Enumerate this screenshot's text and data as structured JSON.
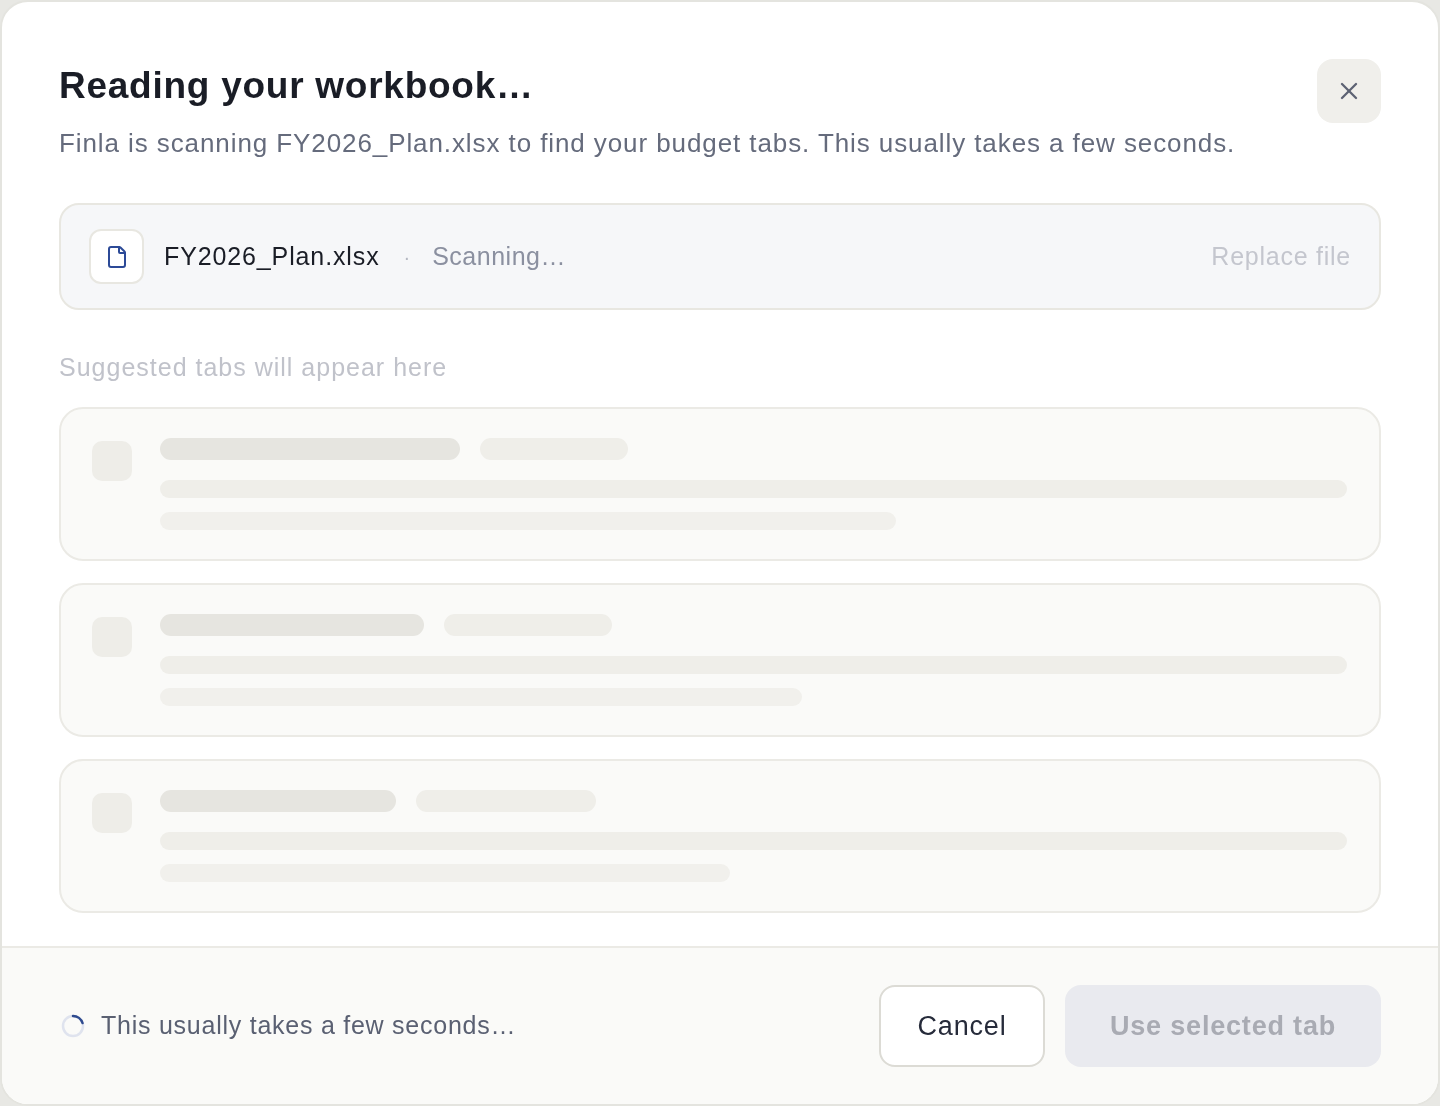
{
  "dialog": {
    "title": "Reading your workbook…",
    "description": "Finla is scanning FY2026_Plan.xlsx to find your budget tabs. This usually takes a few seconds."
  },
  "file": {
    "name": "FY2026_Plan.xlsx",
    "separator": "·",
    "status": "Scanning…",
    "action": {
      "label": "Replace file",
      "disabled": true
    }
  },
  "suggestions": {
    "heading": "Suggested tabs will appear here",
    "loading": true
  },
  "footer": {
    "busy": true,
    "status": "This usually takes a few seconds…",
    "buttons": [
      {
        "label": "Cancel",
        "kind": "secondary",
        "disabled": false
      },
      {
        "label": "Use selected tab",
        "kind": "primary",
        "disabled": true
      }
    ]
  }
}
